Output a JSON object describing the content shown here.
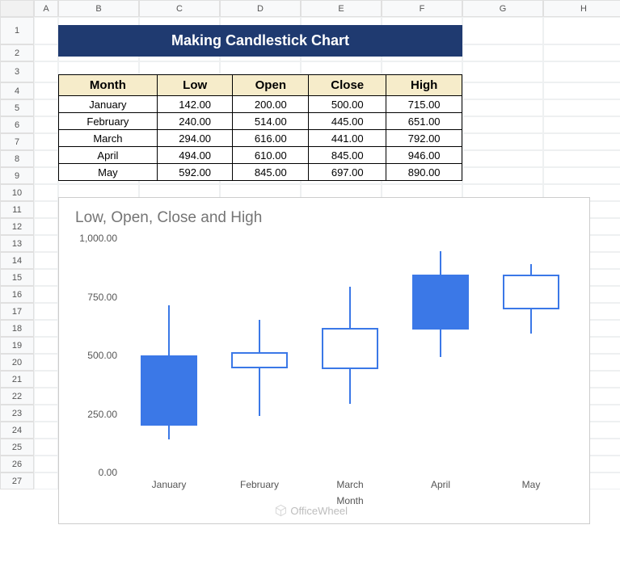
{
  "columns": [
    "A",
    "B",
    "C",
    "D",
    "E",
    "F",
    "G",
    "H"
  ],
  "rowcount": 27,
  "banner": "Making Candlestick Chart",
  "headers": [
    "Month",
    "Low",
    "Open",
    "Close",
    "High"
  ],
  "rows": [
    {
      "m": "January",
      "l": "142.00",
      "o": "200.00",
      "c": "500.00",
      "h": "715.00"
    },
    {
      "m": "February",
      "l": "240.00",
      "o": "514.00",
      "c": "445.00",
      "h": "651.00"
    },
    {
      "m": "March",
      "l": "294.00",
      "o": "616.00",
      "c": "441.00",
      "h": "792.00"
    },
    {
      "m": "April",
      "l": "494.00",
      "o": "610.00",
      "c": "845.00",
      "h": "946.00"
    },
    {
      "m": "May",
      "l": "592.00",
      "o": "845.00",
      "c": "697.00",
      "h": "890.00"
    }
  ],
  "chart_data": {
    "type": "candlestick",
    "title": "Low, Open, Close and High",
    "xlabel": "Month",
    "ylabel": "",
    "ylim": [
      0,
      1000
    ],
    "yticks": [
      "0.00",
      "250.00",
      "500.00",
      "750.00",
      "1,000.00"
    ],
    "categories": [
      "January",
      "February",
      "March",
      "April",
      "May"
    ],
    "series": [
      {
        "name": "January",
        "low": 142,
        "open": 200,
        "close": 500,
        "high": 715
      },
      {
        "name": "February",
        "low": 240,
        "open": 514,
        "close": 445,
        "high": 651
      },
      {
        "name": "March",
        "low": 294,
        "open": 616,
        "close": 441,
        "high": 792
      },
      {
        "name": "April",
        "low": 494,
        "open": 610,
        "close": 845,
        "high": 946
      },
      {
        "name": "May",
        "low": 592,
        "open": 845,
        "close": 697,
        "high": 890
      }
    ]
  },
  "watermark": "OfficeWheel"
}
